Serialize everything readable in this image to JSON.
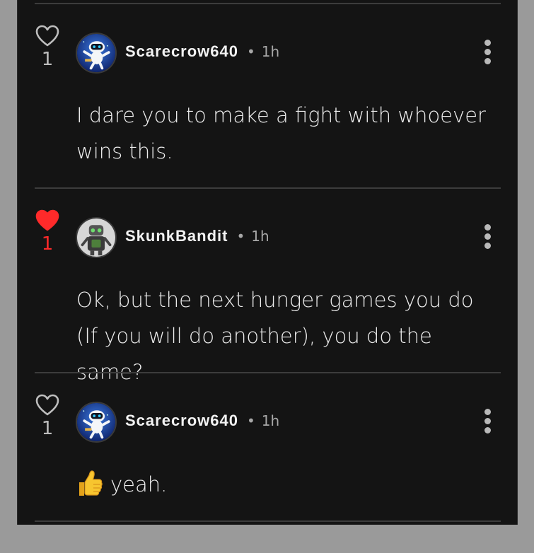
{
  "comments": [
    {
      "username": "Scarecrow640",
      "separator": "•",
      "time": "1h",
      "like_count": "1",
      "liked": false,
      "text": "I dare you to make a fight with whoever wins this.",
      "avatar": "robot-avatar-blue"
    },
    {
      "username": "SkunkBandit",
      "separator": "•",
      "time": "1h",
      "like_count": "1",
      "liked": true,
      "text": "Ok, but the next hunger games you do (If you will do another), you do the same?",
      "avatar": "robot-avatar-grey"
    },
    {
      "username": "Scarecrow640",
      "separator": "•",
      "time": "1h",
      "like_count": "1",
      "liked": false,
      "text": "yeah.",
      "emoji": "thumbs-up-emoji",
      "avatar": "robot-avatar-blue"
    }
  ],
  "colors": {
    "background": "#141414",
    "liked": "#ff2a2a",
    "text": "#ededed",
    "muted": "#a8a8a8"
  }
}
